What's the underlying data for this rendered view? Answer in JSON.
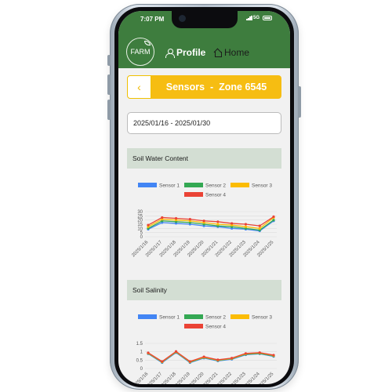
{
  "status_bar": {
    "time": "7:07 PM",
    "network": "5G"
  },
  "header": {
    "logo_text": "FARM",
    "nav": [
      {
        "label": "Profile",
        "icon": "person-icon",
        "active": true
      },
      {
        "label": "Home",
        "icon": "house-icon",
        "active": false
      }
    ]
  },
  "zone": {
    "back_icon": "‹",
    "title": "Sensors  -  Zone 6545"
  },
  "date_range": {
    "value": "2025/01/16 - 2025/01/30"
  },
  "colors": {
    "header_green": "#3e7d3e",
    "accent_yellow": "#f6bd12",
    "section_bg": "#d3ded3"
  },
  "chart_data": [
    {
      "type": "line",
      "title": "Soil Water Content",
      "categories": [
        "2025/1/16",
        "2025/1/17",
        "2025/1/18",
        "2025/1/19",
        "2025/1/20",
        "2025/1/21",
        "2025/1/22",
        "2025/1/23",
        "2025/1/24",
        "2025/1/25"
      ],
      "yticks": [
        "0",
        "5",
        "10",
        "15",
        "20",
        "25",
        "30"
      ],
      "ylim": [
        0,
        30
      ],
      "legend_position": "top",
      "grid": true,
      "series": [
        {
          "name": "Sensor 1",
          "color": "#4285f4",
          "values": [
            9,
            17,
            16,
            15,
            13,
            12,
            10,
            9,
            7,
            19
          ]
        },
        {
          "name": "Sensor 2",
          "color": "#34a853",
          "values": [
            10,
            19,
            18,
            17,
            15,
            13,
            12,
            10,
            8,
            20
          ]
        },
        {
          "name": "Sensor 3",
          "color": "#fbbc04",
          "values": [
            12,
            21,
            20,
            19,
            17,
            15,
            14,
            12,
            10,
            23
          ]
        },
        {
          "name": "Sensor 4",
          "color": "#ea4335",
          "values": [
            14,
            23,
            22,
            21,
            19,
            18,
            16,
            15,
            13,
            24
          ]
        }
      ]
    },
    {
      "type": "line",
      "title": "Soil Salinity",
      "categories": [
        "2025/1/16",
        "2025/1/17",
        "2025/1/18",
        "2025/1/19",
        "2025/1/20",
        "2025/1/21",
        "2025/1/22",
        "2025/1/23",
        "2025/1/24",
        "2025/1/25"
      ],
      "yticks": [
        "0",
        "0.5",
        "1",
        "1.5"
      ],
      "ylim": [
        0,
        1.5
      ],
      "legend_position": "top",
      "grid": true,
      "series": [
        {
          "name": "Sensor 1",
          "color": "#4285f4",
          "values": [
            0.88,
            0.35,
            0.95,
            0.35,
            0.62,
            0.45,
            0.55,
            0.82,
            0.88,
            0.72
          ]
        },
        {
          "name": "Sensor 2",
          "color": "#34a853",
          "values": [
            0.9,
            0.38,
            0.98,
            0.38,
            0.65,
            0.48,
            0.58,
            0.85,
            0.9,
            0.75
          ]
        },
        {
          "name": "Sensor 3",
          "color": "#fbbc04",
          "values": [
            0.92,
            0.4,
            1.0,
            0.4,
            0.67,
            0.5,
            0.6,
            0.88,
            0.93,
            0.78
          ]
        },
        {
          "name": "Sensor 4",
          "color": "#ea4335",
          "values": [
            0.94,
            0.42,
            1.02,
            0.42,
            0.7,
            0.52,
            0.62,
            0.9,
            0.95,
            0.8
          ]
        }
      ]
    }
  ]
}
